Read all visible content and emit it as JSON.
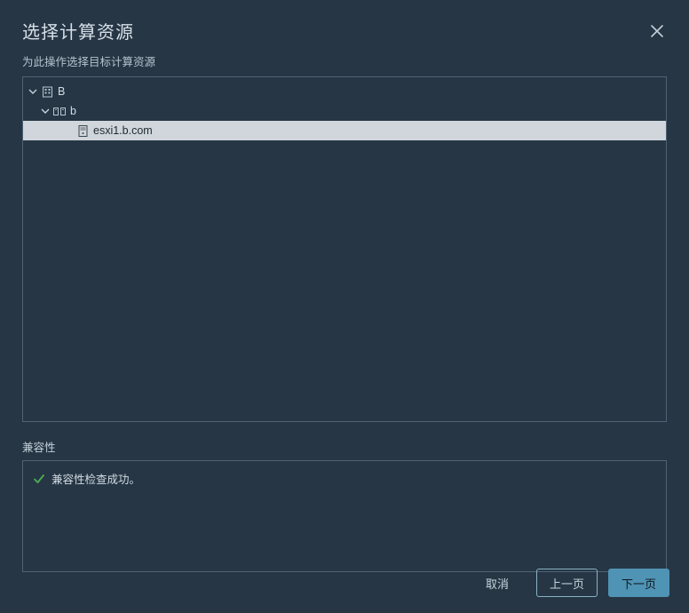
{
  "header": {
    "title": "选择计算资源",
    "subtitle": "为此操作选择目标计算资源"
  },
  "tree": {
    "nodes": [
      {
        "label": "B",
        "icon": "datacenter-icon"
      },
      {
        "label": "b",
        "icon": "cluster-icon"
      },
      {
        "label": "esxi1.b.com",
        "icon": "host-icon"
      }
    ]
  },
  "compat": {
    "section_label": "兼容性",
    "status_text": "兼容性检查成功。"
  },
  "footer": {
    "cancel": "取消",
    "back": "上一页",
    "next": "下一页"
  }
}
